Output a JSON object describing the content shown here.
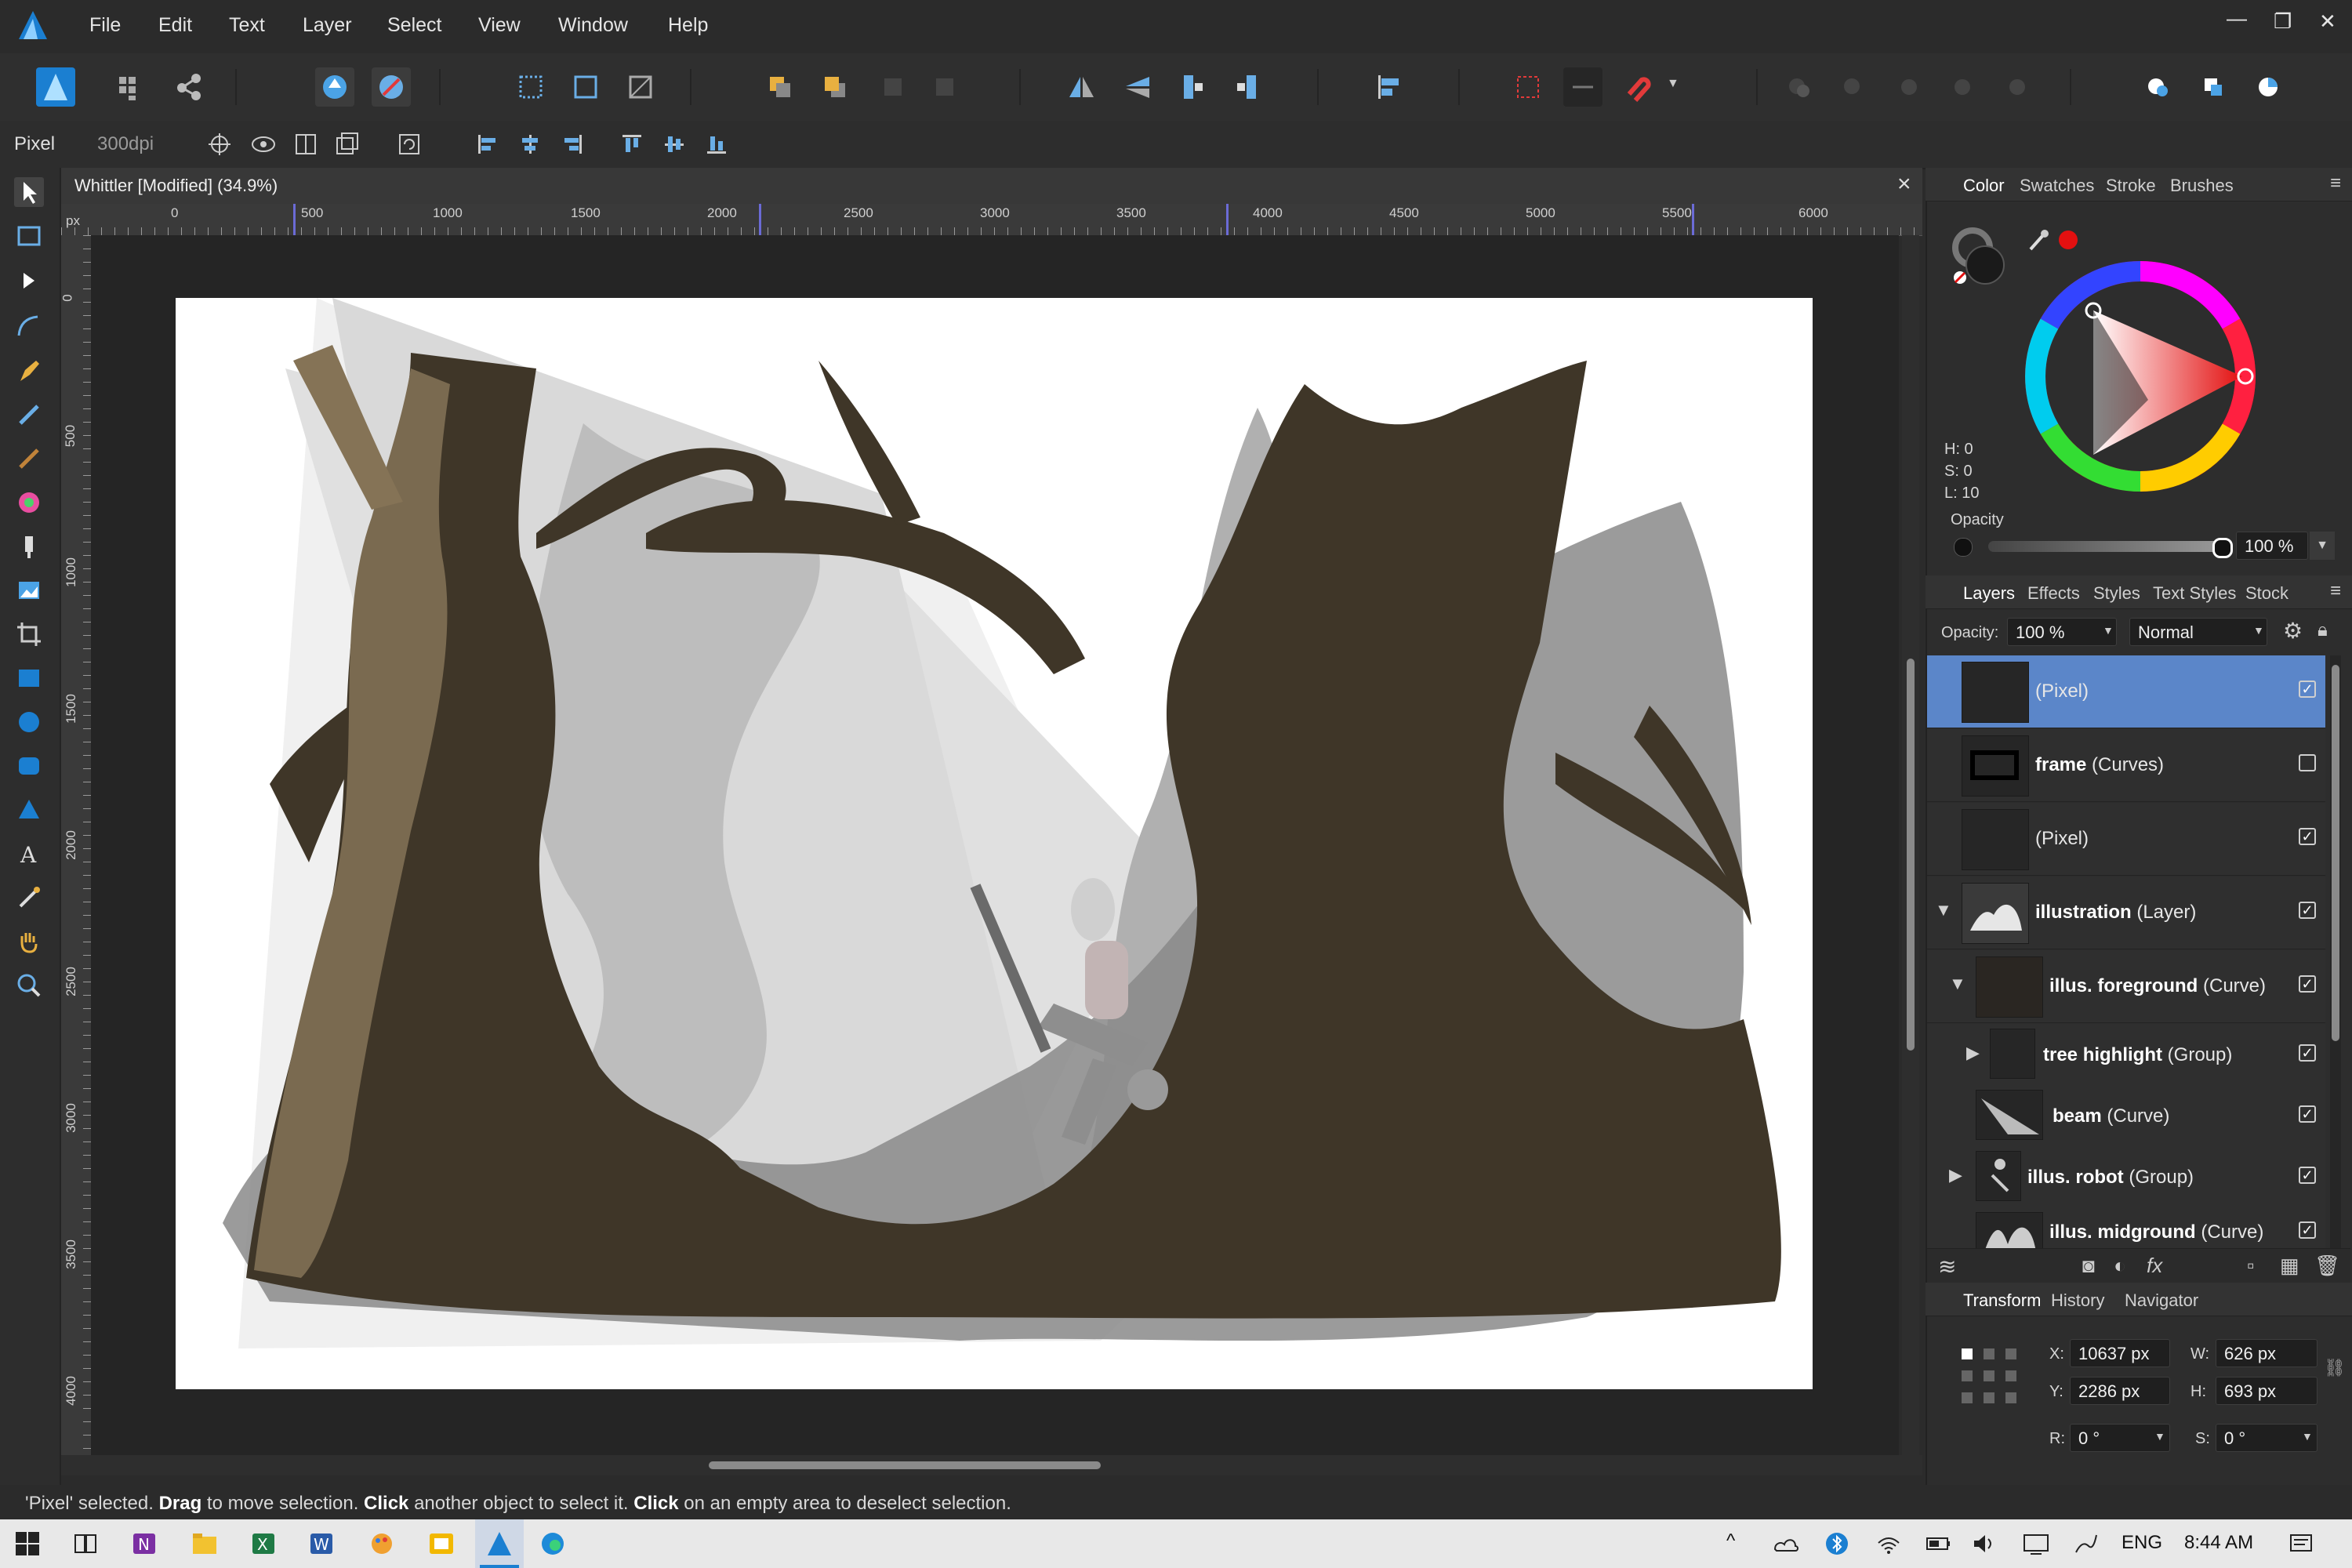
{
  "app": {
    "name": "Affinity Designer"
  },
  "menu": [
    "File",
    "Edit",
    "Text",
    "Layer",
    "Select",
    "View",
    "Window",
    "Help"
  ],
  "window_controls": [
    "minimize",
    "restore",
    "close"
  ],
  "context": {
    "persona_label": "Pixel",
    "dpi": "300dpi"
  },
  "document": {
    "title": "Whittler [Modified] (34.9%)",
    "ruler_unit": "px",
    "ruler_h": [
      "0",
      "500",
      "1000",
      "1500",
      "2000",
      "2500",
      "3000",
      "3500",
      "4000",
      "4500",
      "5000",
      "5500",
      "6000"
    ],
    "ruler_v": [
      "0",
      "500",
      "1000",
      "1500",
      "2000",
      "2500",
      "3000",
      "3500",
      "4000"
    ]
  },
  "color_panel": {
    "tabs": [
      "Color",
      "Swatches",
      "Stroke",
      "Brushes"
    ],
    "hsl": {
      "h": "H: 0",
      "s": "S: 0",
      "l": "L: 10"
    },
    "opacity_label": "Opacity",
    "opacity_value": "100 %",
    "colors": {
      "fill": "#1a1a1a",
      "picker_accent": "#e31010"
    }
  },
  "layers_panel": {
    "tabs": [
      "Layers",
      "Effects",
      "Styles",
      "Text Styles",
      "Stock"
    ],
    "opacity_label": "Opacity:",
    "opacity_value": "100 %",
    "blend_mode": "Normal",
    "rows": [
      {
        "name": "",
        "type": "(Pixel)",
        "checked": true,
        "selected": true
      },
      {
        "name": "frame",
        "type": "(Curves)",
        "checked": false
      },
      {
        "name": "",
        "type": "(Pixel)",
        "checked": true
      },
      {
        "name": "illustration",
        "type": "(Layer)",
        "checked": true
      },
      {
        "name": "illus. foreground",
        "type": "(Curve)",
        "checked": true
      },
      {
        "name": "tree highlight",
        "type": "(Group)",
        "checked": true
      },
      {
        "name": "beam",
        "type": "(Curve)",
        "checked": true
      },
      {
        "name": "illus. robot",
        "type": "(Group)",
        "checked": true
      },
      {
        "name": "illus. midground",
        "type": "(Curve)",
        "checked": true
      }
    ],
    "check_glyph": "✓",
    "expand_glyph": "▶",
    "collapse_glyph": "▼"
  },
  "transform_panel": {
    "tabs": [
      "Transform",
      "History",
      "Navigator"
    ],
    "x_label": "X:",
    "x_value": "10637 px",
    "y_label": "Y:",
    "y_value": "2286 px",
    "w_label": "W:",
    "w_value": "626 px",
    "h_label": "H:",
    "h_value": "693 px",
    "r_label": "R:",
    "r_value": "0 °",
    "s_label": "S:",
    "s_value": "0 °"
  },
  "status": {
    "q1": "'Pixel' selected. ",
    "b1": "Drag",
    "t1": " to move selection. ",
    "b2": "Click",
    "t2": " another object to select it. ",
    "b3": "Click",
    "t3": " on an empty area to deselect selection."
  },
  "taskbar": {
    "language": "ENG",
    "time": "8:44 AM"
  },
  "accent_colors": {
    "selection_blue": "#5b86c9",
    "tree_brown": "#3f3628",
    "ui_dark": "#2b2b2b"
  }
}
